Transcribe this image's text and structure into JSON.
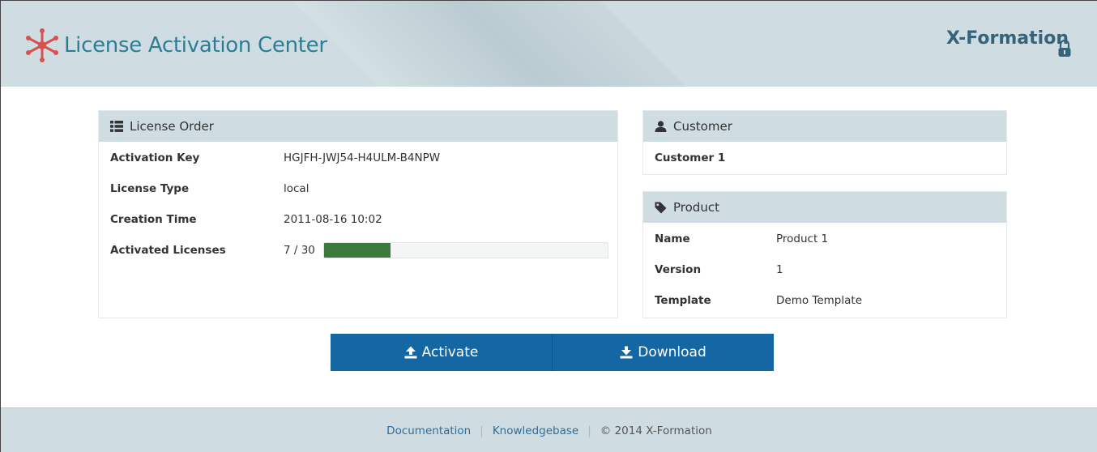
{
  "header": {
    "title": "License Activation Center",
    "vendor_logo": "X-Formation",
    "brand_icon": "snowflake-star-icon",
    "brand_color": "#d9514e",
    "title_color": "#2d7e95"
  },
  "license_order": {
    "heading": "License Order",
    "icon": "list-icon",
    "rows": [
      {
        "label": "Activation Key",
        "value": "HGJFH-JWJ54-H4ULM-B4NPW"
      },
      {
        "label": "License Type",
        "value": "local"
      },
      {
        "label": "Creation Time",
        "value": "2011-08-16 10:02"
      }
    ],
    "activated": {
      "label": "Activated Licenses",
      "value": "7 / 30",
      "used": 7,
      "total": 30,
      "bar_color": "#3b7a3c"
    }
  },
  "customer": {
    "heading": "Customer",
    "icon": "user-icon",
    "name": "Customer 1"
  },
  "product": {
    "heading": "Product",
    "icon": "tag-icon",
    "rows": [
      {
        "label": "Name",
        "value": "Product 1"
      },
      {
        "label": "Version",
        "value": "1"
      },
      {
        "label": "Template",
        "value": "Demo Template"
      }
    ]
  },
  "actions": {
    "activate_label": "Activate",
    "download_label": "Download",
    "button_color": "#1467a2"
  },
  "footer": {
    "documentation": "Documentation",
    "knowledgebase": "Knowledgebase",
    "copyright": "© 2014 X-Formation"
  }
}
